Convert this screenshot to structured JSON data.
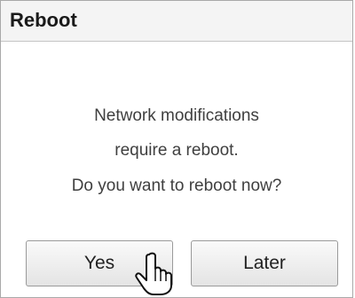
{
  "dialog": {
    "title": "Reboot",
    "message_lines": [
      "Network modifications",
      "require a reboot.",
      "Do you want to reboot now?"
    ],
    "buttons": {
      "yes_label": "Yes",
      "later_label": "Later"
    }
  },
  "cursor": {
    "icon": "hand-pointer-icon"
  }
}
